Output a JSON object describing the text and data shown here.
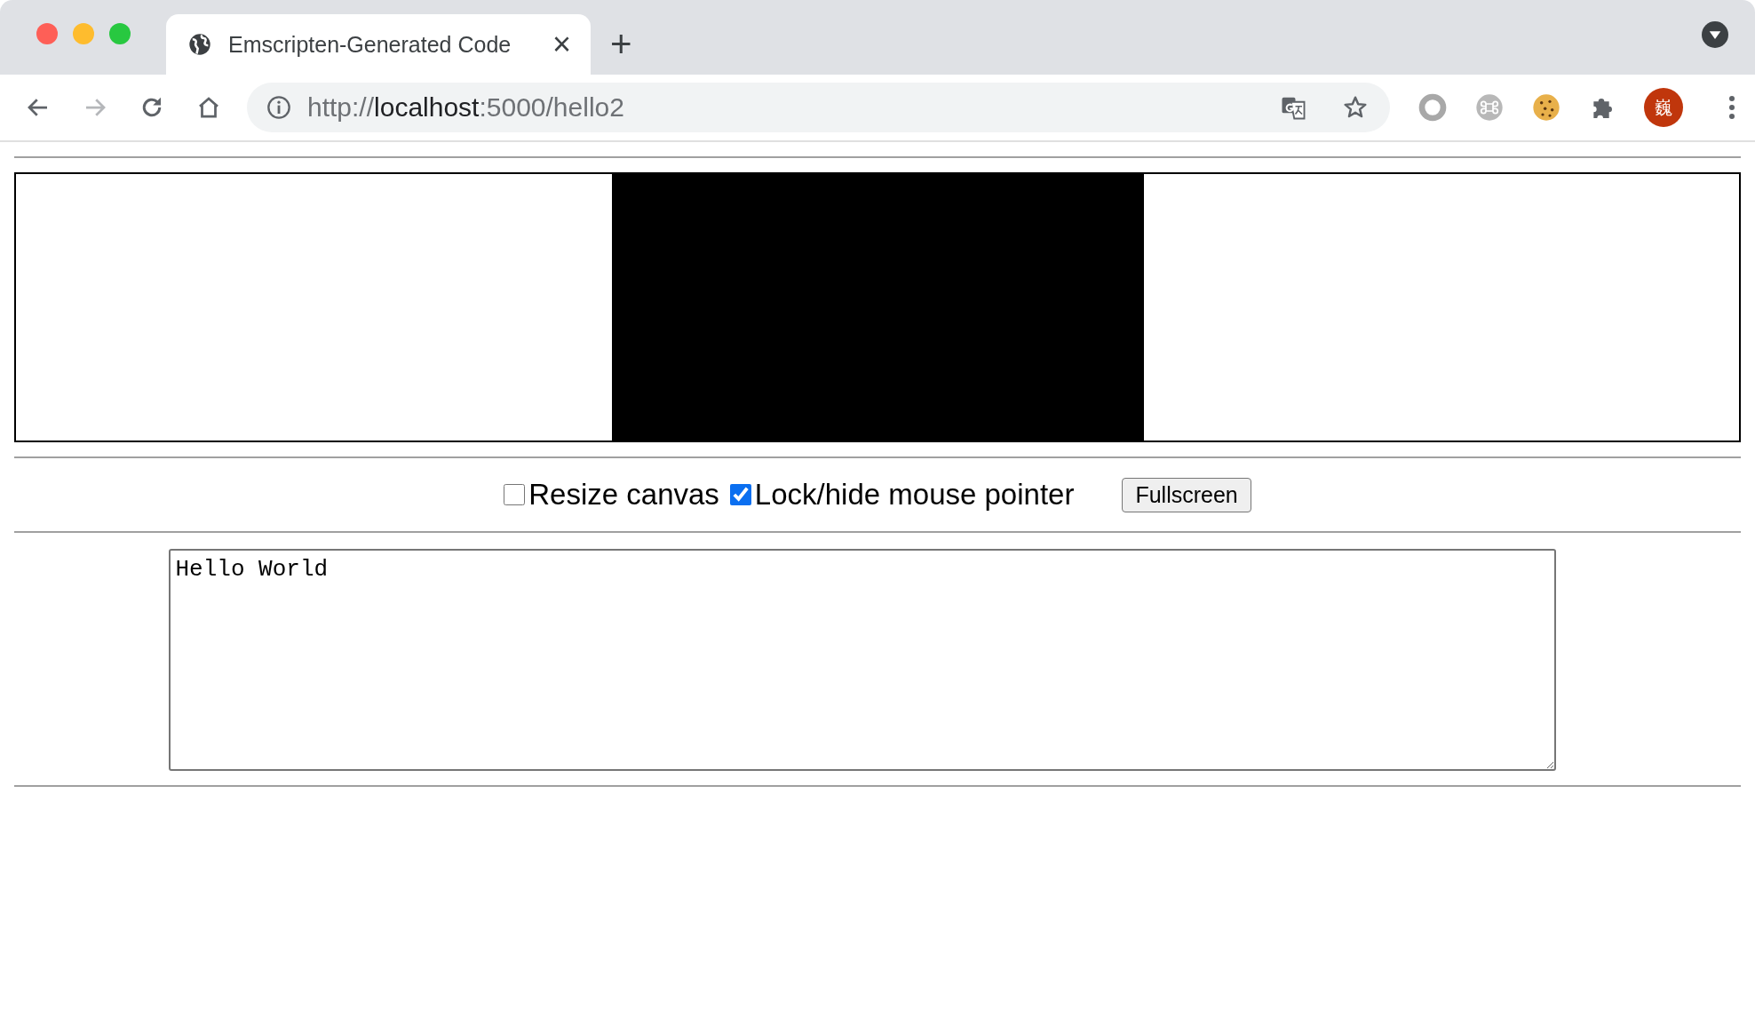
{
  "tabs": [
    {
      "title": "Emscripten-Generated Code",
      "selected": true
    }
  ],
  "new_tab": "+",
  "tab_close": "×",
  "address_bar": {
    "scheme": "http://",
    "host": "localhost",
    "path": ":5000/hello2"
  },
  "profile": {
    "initial": "巍"
  },
  "options": [
    {
      "label": "Resize canvas",
      "checked": false
    },
    {
      "label": "Lock/hide mouse pointer",
      "checked": true
    }
  ],
  "fullscreen_button": "Fullscreen",
  "output": {
    "value": "Hello World"
  }
}
